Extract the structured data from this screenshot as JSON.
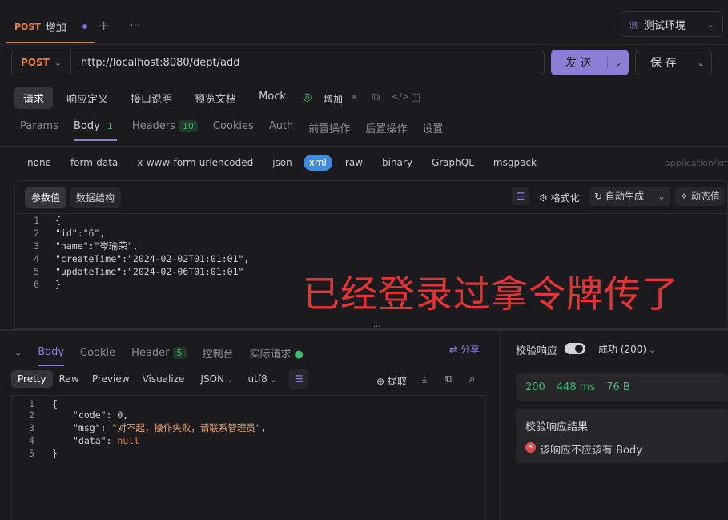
{
  "tabbar": {
    "tab_method": "POST",
    "tab_title": "增加",
    "add_label": "+",
    "more_label": "···",
    "env_badge": "测",
    "env_label": "测试环境"
  },
  "request": {
    "method": "POST",
    "url": "http://localhost:8080/dept/add",
    "send_label": "发 送",
    "save_label": "保 存"
  },
  "subtabs": [
    "请求",
    "响应定义",
    "接口说明",
    "预览文档",
    "Mock"
  ],
  "endpoint_name": "增加",
  "paramtabs": {
    "params": "Params",
    "body": "Body",
    "body_count": "1",
    "headers": "Headers",
    "headers_count": "10",
    "cookies": "Cookies",
    "auth": "Auth",
    "pre": "前置操作",
    "post": "后置操作",
    "settings": "设置"
  },
  "bodytypes": [
    "none",
    "form-data",
    "x-www-form-urlencoded",
    "json",
    "xml",
    "raw",
    "binary",
    "GraphQL",
    "msgpack"
  ],
  "content_type": "application/xm",
  "editor": {
    "tab_params": "参数值",
    "tab_schema": "数据结构",
    "format_label": "格式化",
    "autogen_label": "自动生成",
    "dynamic_label": "动态值",
    "lines": [
      {
        "n": "1",
        "text": "{"
      },
      {
        "n": "2",
        "text": "\"id\":\"6\","
      },
      {
        "n": "3",
        "text": "\"name\":\"岑瑜荣\","
      },
      {
        "n": "4",
        "text": "\"createTime\":\"2024-02-02T01:01:01\","
      },
      {
        "n": "5",
        "text": "\"updateTime\":\"2024-02-06T01:01:01\""
      },
      {
        "n": "6",
        "text": "}"
      }
    ]
  },
  "overlay_text": "已经登录过拿令牌传了",
  "response": {
    "tabs": {
      "body": "Body",
      "cookie": "Cookie",
      "header": "Header",
      "header_count": "5",
      "console": "控制台",
      "actual": "实际请求"
    },
    "share_label": "分享",
    "views": [
      "Pretty",
      "Raw",
      "Preview",
      "Visualize"
    ],
    "format": "JSON",
    "encoding": "utf8",
    "extract_label": "提取",
    "lines": [
      {
        "n": "1",
        "text": "{"
      },
      {
        "n": "2",
        "key": "\"code\"",
        "value": "0",
        "tail": ","
      },
      {
        "n": "3",
        "key": "\"msg\"",
        "value": "\"对不起，操作失败，请联系管理员\"",
        "tail": ","
      },
      {
        "n": "4",
        "key": "\"data\"",
        "value": "null",
        "tail": ""
      },
      {
        "n": "5",
        "text": "}"
      }
    ]
  },
  "verify": {
    "title": "校验响应",
    "status": "成功 (200)",
    "code": "200",
    "time": "448 ms",
    "size": "76 B",
    "result_title": "校验响应结果",
    "result_text": "该响应不应该有 Body"
  },
  "colors": {
    "accent": "#8a7fd4",
    "method": "#e8843a",
    "success": "#3fb96b",
    "error": "#e5484d",
    "overlay": "#e63333"
  }
}
